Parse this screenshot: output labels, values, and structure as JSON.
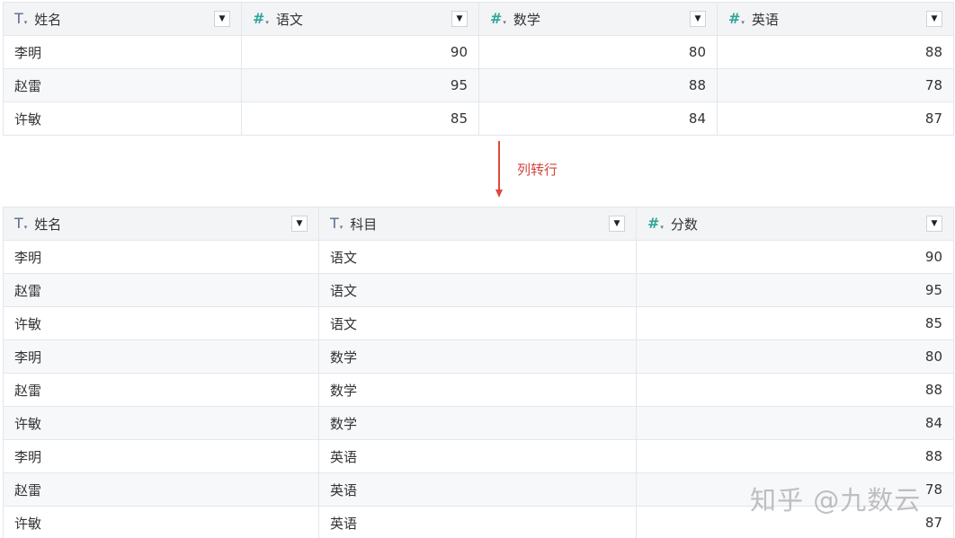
{
  "top_table": {
    "headers": [
      {
        "type_icon": "text-type-icon",
        "label": "姓名"
      },
      {
        "type_icon": "number-type-icon",
        "label": "语文"
      },
      {
        "type_icon": "number-type-icon",
        "label": "数学"
      },
      {
        "type_icon": "number-type-icon",
        "label": "英语"
      }
    ],
    "rows": [
      [
        "李明",
        "90",
        "80",
        "88"
      ],
      [
        "赵雷",
        "95",
        "88",
        "78"
      ],
      [
        "许敏",
        "85",
        "84",
        "87"
      ]
    ]
  },
  "transform": {
    "label": "列转行",
    "color": "#e0473e"
  },
  "bottom_table": {
    "headers": [
      {
        "type_icon": "text-type-icon",
        "label": "姓名"
      },
      {
        "type_icon": "text-type-icon",
        "label": "科目"
      },
      {
        "type_icon": "number-type-icon",
        "label": "分数"
      }
    ],
    "rows": [
      [
        "李明",
        "语文",
        "90"
      ],
      [
        "赵雷",
        "语文",
        "95"
      ],
      [
        "许敏",
        "语文",
        "85"
      ],
      [
        "李明",
        "数学",
        "80"
      ],
      [
        "赵雷",
        "数学",
        "88"
      ],
      [
        "许敏",
        "数学",
        "84"
      ],
      [
        "李明",
        "英语",
        "88"
      ],
      [
        "赵雷",
        "英语",
        "78"
      ],
      [
        "许敏",
        "英语",
        "87"
      ]
    ]
  },
  "glyphs": {
    "text_type": "T",
    "number_type": "#",
    "sort_tri": "▾",
    "dropdown": "▼"
  },
  "colors": {
    "header_bg": "#f3f4f6",
    "alt_row_bg": "#f7f8fa",
    "border": "#e3e6eb",
    "number_icon": "#2fa59a",
    "text_icon": "#5a6b8c"
  },
  "watermark": "知乎 @九数云"
}
